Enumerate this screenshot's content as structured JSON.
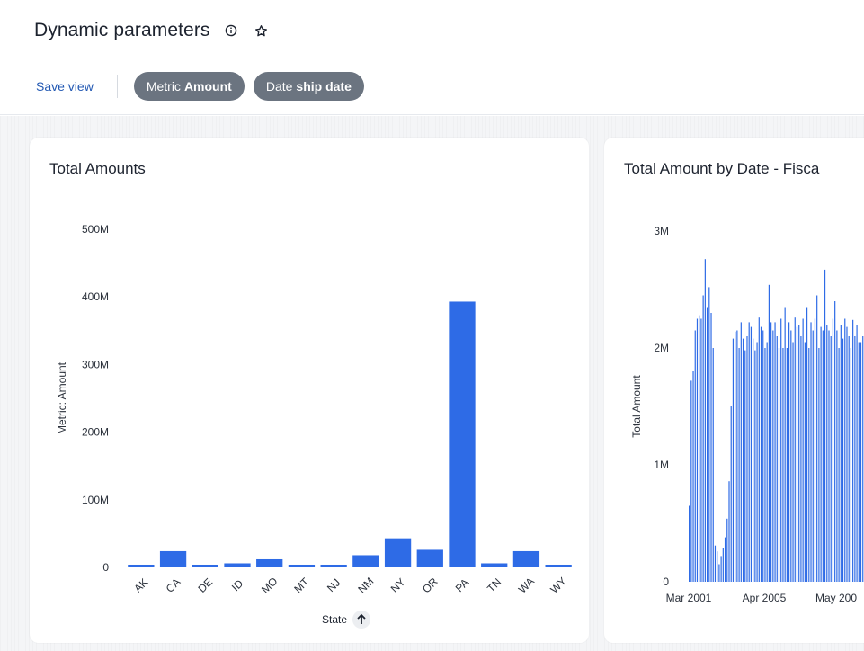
{
  "header": {
    "title": "Dynamic parameters",
    "save_view_label": "Save view",
    "chips": [
      {
        "prefix": "Metric",
        "value": "Amount"
      },
      {
        "prefix": "Date",
        "value": "ship date"
      }
    ]
  },
  "icons": {
    "info": "info-icon",
    "star": "star-icon",
    "sort": "arrow-up-icon"
  },
  "colors": {
    "accent": "#2359b3",
    "bar": "#2e6be6",
    "chip": "#6b7480"
  },
  "charts": [
    {
      "card_title": "Total Amounts",
      "chart_data": {
        "type": "bar",
        "title": "Total Amounts",
        "xlabel": "State",
        "ylabel": "Metric: Amount",
        "ylim": [
          0,
          500000000
        ],
        "y_ticks": [
          "0",
          "100M",
          "200M",
          "300M",
          "400M",
          "500M"
        ],
        "categories": [
          "AK",
          "CA",
          "DE",
          "ID",
          "MO",
          "MT",
          "NJ",
          "NM",
          "NY",
          "OR",
          "PA",
          "TN",
          "WA",
          "WY"
        ],
        "values": [
          4000000,
          24000000,
          4000000,
          6000000,
          12000000,
          4000000,
          4000000,
          18000000,
          43000000,
          26000000,
          393000000,
          6000000,
          24000000,
          4000000
        ],
        "sort": "ascending"
      }
    },
    {
      "card_title": "Total Amount by Date - Fisca",
      "chart_data": {
        "type": "bar",
        "title": "Total Amount by Date - Fisca",
        "ylabel": "Total Amount",
        "ylim": [
          0,
          3000000
        ],
        "y_ticks": [
          "0",
          "1M",
          "2M",
          "3M"
        ],
        "x_ticks": [
          "Mar 2001",
          "Apr 2005",
          "May 200"
        ],
        "values": [
          650000,
          1720000,
          1800000,
          2150000,
          2250000,
          2280000,
          2250000,
          2450000,
          2760000,
          2350000,
          2520000,
          2300000,
          2000000,
          310000,
          260000,
          150000,
          220000,
          290000,
          380000,
          540000,
          860000,
          1500000,
          2080000,
          2140000,
          2150000,
          2000000,
          2220000,
          2080000,
          1980000,
          2100000,
          2220000,
          2180000,
          2080000,
          1980000,
          2050000,
          2260000,
          2180000,
          2150000,
          2000000,
          2050000,
          2540000,
          2220000,
          2150000,
          2220000,
          2100000,
          2000000,
          2250000,
          2000000,
          2350000,
          2000000,
          2220000,
          2150000,
          2050000,
          2260000,
          2180000,
          2200000,
          2100000,
          2250000,
          2050000,
          2350000,
          2000000,
          2220000,
          2150000,
          2250000,
          2450000,
          2000000,
          2180000,
          2150000,
          2670000,
          2200000,
          2150000,
          2100000,
          2250000,
          2400000,
          2150000,
          2000000,
          2200000,
          2080000,
          2250000,
          2180000,
          2100000,
          2000000,
          2240000,
          2100000,
          2200000,
          2050000,
          2050000,
          2100000,
          2000000,
          2150000,
          2500000,
          2000000,
          2300000,
          1980000,
          2100000,
          2200000,
          2000000
        ]
      }
    }
  ]
}
